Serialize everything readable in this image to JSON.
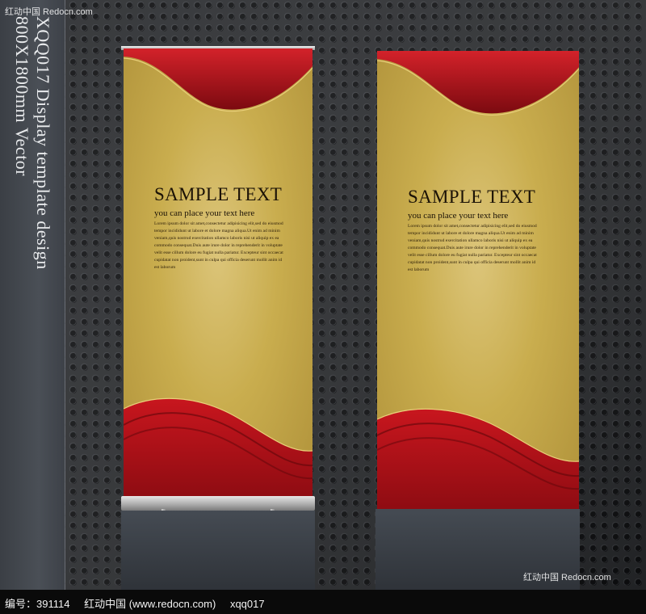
{
  "watermark_top": "红动中国 Redocn.com",
  "watermark_bottom_right": "红动中国 Redocn.com",
  "side_caption": {
    "line1": "XQQ017 Display template design",
    "line2": "800X1800mm Vector"
  },
  "banners": [
    {
      "headline": "SAMPLE TEXT",
      "subline": "you can place your text here",
      "body": "Lorem ipsum dolor sit amet,consectetur adipisicing elit,sed do eiusmod tempor incididunt ut labore et dolore magna aliqua.Ut enim ad minim veniam,quis nostrud exercitation ullamco laboris nisi ut aliquip ex ea commodo consequat.Duis aute irure dolor in reprehenderit in voluptate velit esse cillum dolore eu fugiat nulla pariatur. Excepteur sint occaecat cupidatat non proident,sunt in culpa qui officia deserunt mollit anim id est laborum"
    },
    {
      "headline": "SAMPLE TEXT",
      "subline": "you can place your text here",
      "body": "Lorem ipsum dolor sit amet,consectetur adipisicing elit,sed do eiusmod tempor incididunt ut labore et dolore magna aliqua.Ut enim ad minim veniam,quis nostrud exercitation ullamco laboris nisi ut aliquip ex ea commodo consequat.Duis aute irure dolor in reprehenderit in voluptate velit esse cillum dolore eu fugiat nulla pariatur. Excepteur sint occaecat cupidatat non proident,sunt in culpa qui officia deserunt mollit anim id est laborum"
    }
  ],
  "footer": {
    "id_label": "编号：391114",
    "site": "红动中国 (www.redocn.com)",
    "code": "xqq017"
  },
  "colors": {
    "banner_gold": "#c9ad4e",
    "wave_red": "#b8121a",
    "background_metal": "#2b2d30"
  }
}
